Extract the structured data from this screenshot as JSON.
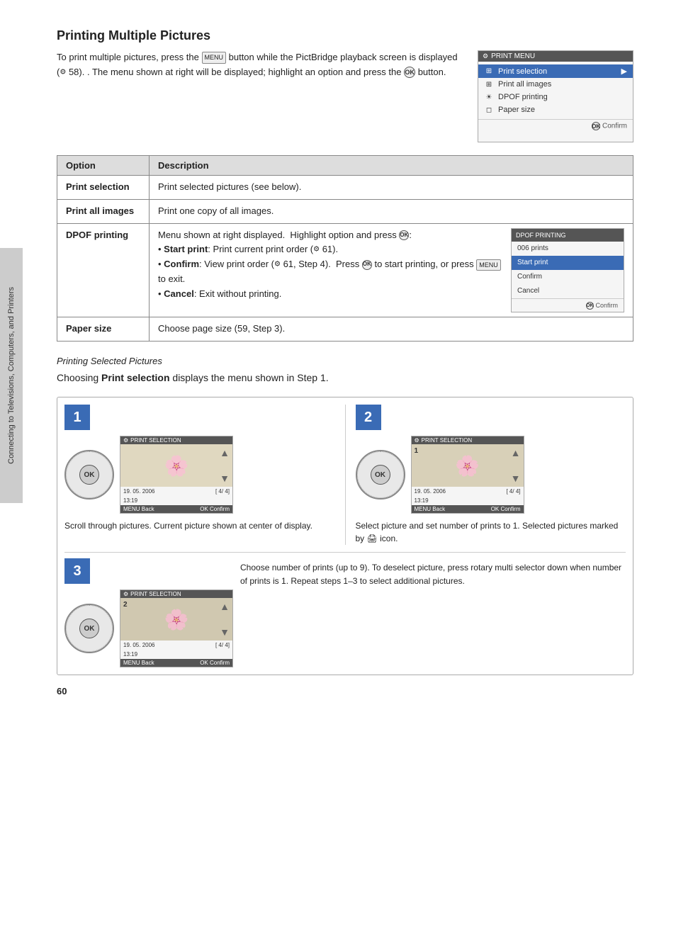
{
  "page": {
    "title": "Printing Multiple Pictures",
    "intro": {
      "text1": "To print multiple pictures, press the",
      "menu_key": "MENU",
      "text2": "button while the PictBridge playback screen is displayed",
      "page_ref1": "58",
      "text3": ". The menu shown at right will be displayed; highlight an option and press the",
      "ok_symbol": "OK",
      "text4": "button."
    },
    "print_menu": {
      "title": "PRINT MENU",
      "items": [
        {
          "label": "Print selection",
          "selected": true,
          "icon": "grid"
        },
        {
          "label": "Print all images",
          "selected": false,
          "icon": "grid9"
        },
        {
          "label": "DPOF printing",
          "selected": false,
          "icon": "sun"
        },
        {
          "label": "Paper size",
          "selected": false,
          "icon": "page"
        }
      ],
      "confirm": "OK Confirm"
    },
    "table": {
      "headers": [
        "Option",
        "Description"
      ],
      "rows": [
        {
          "option": "Print selection",
          "description": "Print selected pictures (see below)."
        },
        {
          "option": "Print all images",
          "description": "Print one copy of all images."
        },
        {
          "option": "DPOF printing",
          "description_parts": [
            "Menu shown at right displayed.  Highlight option and press",
            "Start print",
            ": Print current print order (",
            "61",
            ").",
            "Confirm",
            ": View print order (",
            "61",
            ", Step 4).  Press",
            "OK",
            "to start printing, or press",
            "MENU",
            "to exit.",
            "Cancel",
            ": Exit without printing."
          ]
        },
        {
          "option": "Paper size",
          "description": "Choose page size (59, Step 3)."
        }
      ]
    },
    "dpof_screen": {
      "title": "DPOF PRINTING",
      "items": [
        {
          "label": "006 prints",
          "highlight": false
        },
        {
          "label": "Start print",
          "highlight": true
        },
        {
          "label": "Confirm",
          "highlight": false
        },
        {
          "label": "Cancel",
          "highlight": false
        }
      ],
      "confirm": "OK Confirm"
    },
    "subtitle": "Printing Selected Pictures",
    "choose_text_before": "Choosing",
    "choose_bold": "Print selection",
    "choose_text_after": "displays the menu shown in Step 1.",
    "steps": [
      {
        "number": "1",
        "screen_title": "PRINT SELECTION",
        "image_emoji": "🌸",
        "date": "19. 05. 2006",
        "time": "13:19",
        "count": "[ 4/  4]",
        "bar": "MENU Back   OK Confirm",
        "caption": "Scroll through pictures.  Current picture shown at center of display."
      },
      {
        "number": "2",
        "screen_title": "PRINT SELECTION",
        "image_emoji": "🌸",
        "date": "19. 05. 2006",
        "time": "13:19",
        "count": "[ 4/  4]",
        "bar": "MENU Back   OK Confirm",
        "caption": "Select picture and set number of prints to 1.  Selected pictures marked by"
      },
      {
        "number": "3",
        "screen_title": "PRINT SELECTION",
        "image_emoji": "🌸",
        "date": "19. 05. 2006",
        "time": "13:19",
        "count": "[ 4/  4]",
        "bar": "MENU Back   OK Confirm",
        "caption": "Choose number of prints (up to 9).  To deselect picture, press rotary multi selector down when number of prints is 1.  Repeat steps 1–3 to select additional pictures."
      }
    ],
    "sidebar_label": "Connecting to Televisions, Computers, and Printers",
    "page_number": "60"
  }
}
